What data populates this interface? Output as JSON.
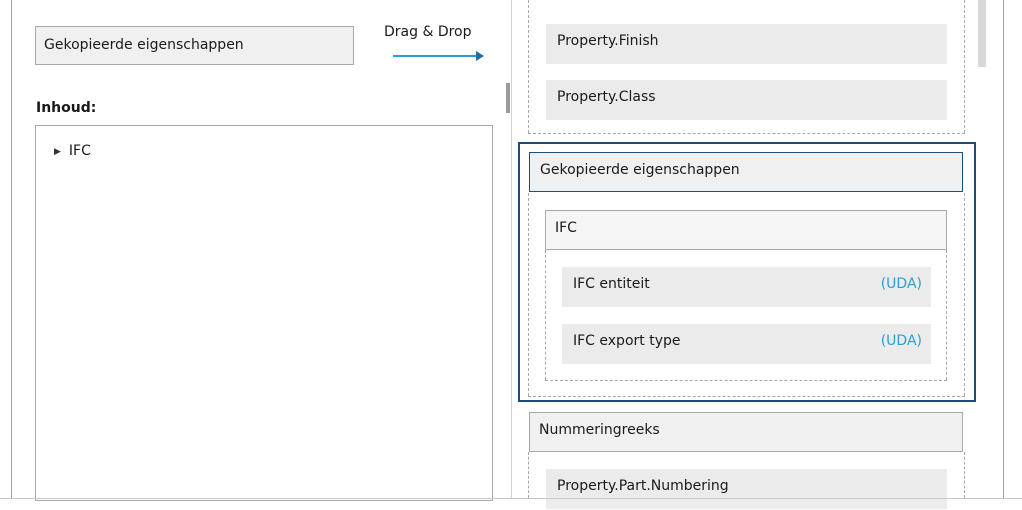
{
  "left": {
    "name_value": "Gekopieerde eigenschappen",
    "drag_drop_label": "Drag & Drop",
    "inhoud_label": "Inhoud:",
    "tree_items": [
      "IFC"
    ]
  },
  "right": {
    "properties_top": [
      "Property.Finish",
      "Property.Class"
    ],
    "group_gekopieerde": {
      "title": "Gekopieerde eigenschappen",
      "subgroup": {
        "title": "IFC",
        "items": [
          {
            "label": "IFC entiteit",
            "tag": "(UDA)"
          },
          {
            "label": "IFC export type",
            "tag": "(UDA)"
          }
        ]
      }
    },
    "group_nummering": {
      "title": "Nummeringreeks",
      "items": [
        "Property.Part.Numbering"
      ]
    }
  },
  "colors": {
    "highlight_border": "#1e4d7a",
    "uda_text": "#2a9fd6",
    "arrow": "#2a9fd6"
  }
}
